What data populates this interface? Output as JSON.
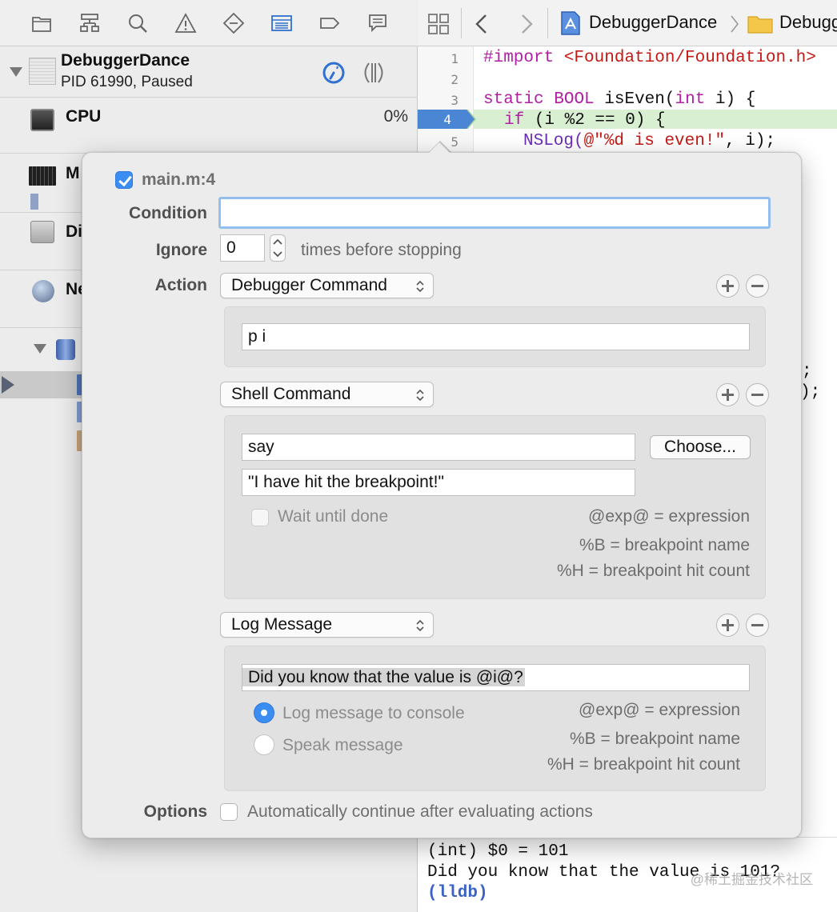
{
  "navigator": {
    "process": {
      "name": "DebuggerDance",
      "status": "PID 61990, Paused"
    },
    "gauges": [
      {
        "label": "CPU",
        "value": "0%"
      },
      {
        "label": "M"
      },
      {
        "label": "Di"
      },
      {
        "label": "Ne"
      }
    ]
  },
  "editor": {
    "jump_bar": {
      "project": "DebuggerDance",
      "folder": "Debugg"
    },
    "line_numbers": [
      "1",
      "2",
      "3",
      "4",
      "5"
    ],
    "code": {
      "line1_kw": "#import",
      "line1_str": "<Foundation/Foundation.h>",
      "line3_kw1": "static",
      "line3_type": "BOOL",
      "line3_rest": " isEven(",
      "line3_kw2": "int",
      "line3_rest2": " i) {",
      "line4_kw": "if",
      "line4_rest": " (i %2 == 0) {",
      "line5_pre": "NSLog(",
      "line5_str": "@\"%d is even!\"",
      "line5_post": ", i);",
      "tail1": ";",
      "tail2": ");"
    },
    "console": {
      "line1": "(int) $0 = 101",
      "line2": "Did you know that the value is 101?",
      "prompt": "(lldb)",
      "watermark": "@稀土掘金技术社区"
    }
  },
  "breakpoint": {
    "enabled": true,
    "location": "main.m:4",
    "condition_label": "Condition",
    "condition_value": "",
    "ignore_label": "Ignore",
    "ignore_value": "0",
    "ignore_suffix": "times before stopping",
    "action_label": "Action",
    "options_label": "Options",
    "auto_continue": {
      "checked": false,
      "label": "Automatically continue after evaluating actions"
    },
    "actions": [
      {
        "type": "Debugger Command",
        "command": "p i"
      },
      {
        "type": "Shell Command",
        "command": "say",
        "arguments": "\"I have hit the breakpoint!\"",
        "choose_label": "Choose...",
        "wait_label": "Wait until done",
        "wait_checked": false,
        "hints": [
          "@exp@ = expression",
          "%B = breakpoint name",
          "%H = breakpoint hit count"
        ]
      },
      {
        "type": "Log Message",
        "message": "Did you know that the value is @i@?",
        "log_option": "Log message to console",
        "speak_option": "Speak message",
        "selected_option": "Log message to console",
        "hints": [
          "@exp@ = expression",
          "%B = breakpoint name",
          "%H = breakpoint hit count"
        ]
      }
    ]
  },
  "colors": {
    "accent": "#3b8df2",
    "breakpoint": "#4a86d4",
    "current_line": "#d9efd2",
    "keyword": "#b11fa5",
    "string": "#c41a16"
  }
}
